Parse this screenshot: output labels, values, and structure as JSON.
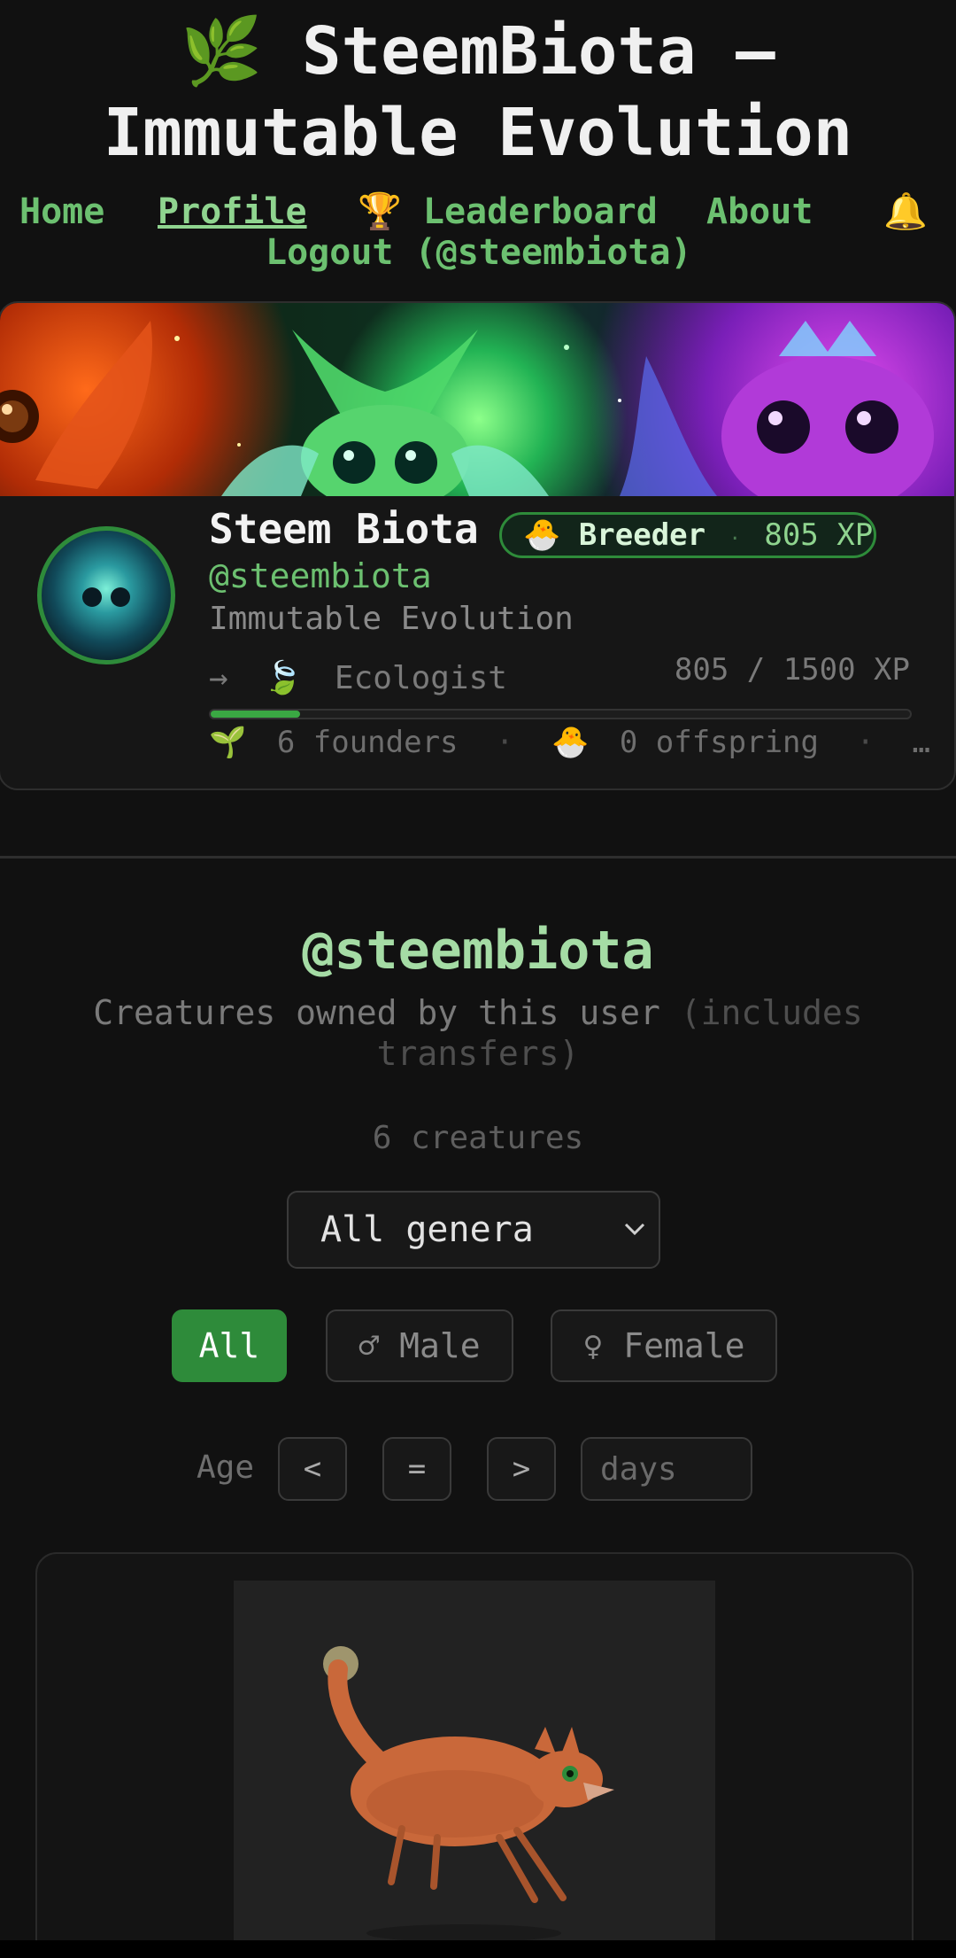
{
  "site": {
    "title_line1": "🌿 SteemBiota —",
    "title_line2": "Immutable Evolution"
  },
  "nav": {
    "home": "Home",
    "profile": "Profile",
    "leaderboard": "🏆 Leaderboard",
    "about": "About",
    "notifications_icon": "🔔",
    "logout": "Logout (@steembiota)"
  },
  "profile": {
    "display_name": "Steem Biota",
    "rank_icon": "🐣",
    "rank": "Breeder",
    "xp_badge": "805 XP",
    "handle": "@steembiota",
    "tagline": "Immutable Evolution",
    "next_rank_arrow": "→",
    "next_rank_icon": "🍃",
    "next_rank": "Ecologist",
    "xp_progress": "805 / 1500 XP",
    "xp_fraction": 0.1273,
    "founders_icon": "🌱",
    "founders": "6 founders",
    "offspring_icon": "🐣",
    "offspring": "0 offspring",
    "separator": "·",
    "more": "…"
  },
  "collection": {
    "owner": "@steembiota",
    "subtitle_main": "Creatures owned by this user",
    "subtitle_dim": "(includes transfers)",
    "count": "6 creatures",
    "genus_select": "All genera",
    "sex_filters": [
      "All",
      "♂ Male",
      "♀ Female"
    ],
    "active_sex_filter": "All",
    "age_label": "Age",
    "age_ops": [
      "<",
      "=",
      ">"
    ],
    "age_placeholder": "days"
  },
  "colors": {
    "background": "#111111",
    "accent_green": "#2e8b3a",
    "link_green": "#6cc070",
    "handle_green": "#a5dca5"
  }
}
